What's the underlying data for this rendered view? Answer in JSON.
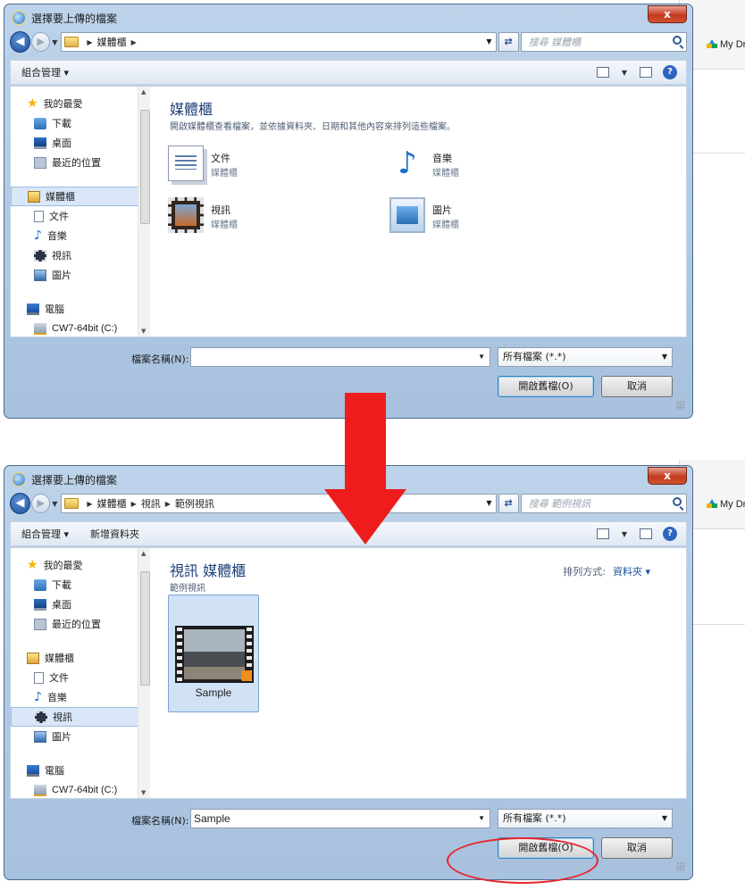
{
  "backdrop": {
    "label": "My Dri"
  },
  "dialog_before": {
    "title": "選擇要上傳的檔案",
    "breadcrumbs": [
      "媒體櫃"
    ],
    "search_placeholder": "搜尋 媒體櫃",
    "toolbar": {
      "organize": "組合管理 ▾"
    },
    "nav": {
      "favorites": "我的最愛",
      "downloads": "下載",
      "desktop": "桌面",
      "recent": "最近的位置",
      "libraries": "媒體櫃",
      "documents": "文件",
      "music": "音樂",
      "videos": "視訊",
      "pictures": "圖片",
      "computer": "電腦",
      "drive": "CW7-64bit (C:)"
    },
    "content": {
      "title": "媒體櫃",
      "description": "開啟媒體櫃查看檔案，並依據資料夾、日期和其他內容來排列這些檔案。",
      "tiles": [
        {
          "name": "文件",
          "sub": "媒體櫃"
        },
        {
          "name": "音樂",
          "sub": "媒體櫃"
        },
        {
          "name": "視訊",
          "sub": "媒體櫃"
        },
        {
          "name": "圖片",
          "sub": "媒體櫃"
        }
      ]
    },
    "filename_label": "檔案名稱(N):",
    "filename_value": "",
    "filetype": "所有檔案 (*.*)",
    "open_button": "開啟舊檔(O)",
    "cancel_button": "取消"
  },
  "dialog_after": {
    "title": "選擇要上傳的檔案",
    "breadcrumbs": [
      "媒體櫃",
      "視訊",
      "範例視訊"
    ],
    "search_placeholder": "搜尋 範例視訊",
    "toolbar": {
      "organize": "組合管理 ▾",
      "new_folder": "新增資料夾"
    },
    "nav": {
      "favorites": "我的最愛",
      "downloads": "下載",
      "desktop": "桌面",
      "recent": "最近的位置",
      "libraries": "媒體櫃",
      "documents": "文件",
      "music": "音樂",
      "videos": "視訊",
      "pictures": "圖片",
      "computer": "電腦",
      "drive": "CW7-64bit (C:)"
    },
    "content": {
      "title": "視訊 媒體櫃",
      "description": "範例視訊",
      "arrange_label": "排列方式:",
      "arrange_value": "資料夾 ▾",
      "file": "Sample"
    },
    "filename_label": "檔案名稱(N):",
    "filename_value": "Sample",
    "filetype": "所有檔案 (*.*)",
    "open_button": "開啟舊檔(O)",
    "cancel_button": "取消"
  },
  "icons": [
    "ie-icon",
    "back-arrow-icon",
    "forward-arrow-icon",
    "folder-icon",
    "refresh-icon",
    "search-icon",
    "view-icon",
    "preview-pane-icon",
    "help-icon",
    "star-icon",
    "download-icon",
    "desktop-icon",
    "recent-places-icon",
    "library-icon",
    "document-icon",
    "music-icon",
    "video-icon",
    "picture-icon",
    "computer-icon",
    "drive-icon"
  ],
  "colors": {
    "annotation": "#ee1c1c",
    "dialog_frame": "#a7c1de",
    "close_button": "#c43a1f"
  }
}
